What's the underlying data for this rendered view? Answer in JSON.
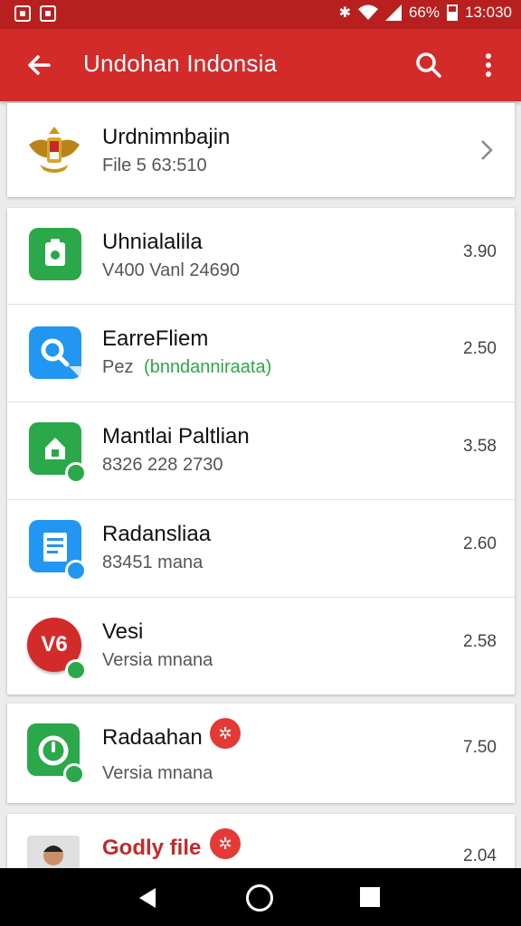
{
  "status_bar": {
    "battery": "66%",
    "time": "13:030"
  },
  "app_bar": {
    "title": "Undohan Indonsia"
  },
  "header_item": {
    "title": "Urdnimnbajin",
    "subtitle": "File 5 63:510"
  },
  "items": [
    {
      "title": "Uhnialalila",
      "subtitle": "V400 Vanl 24690",
      "value": "3.90"
    },
    {
      "title": "EarreFliem",
      "subtitle_prefix": "Pez",
      "subtitle_highlight": "(bnndanniraata)",
      "value": "2.50"
    },
    {
      "title": "Mantlai Paltlian",
      "subtitle": "8326 228 2730",
      "value": "3.58"
    },
    {
      "title": "Radansliaa",
      "subtitle": "83451 mana",
      "value": "2.60"
    },
    {
      "title": "Vesi",
      "subtitle": "Versia mnana",
      "value": "2.58",
      "icon_text": "V6"
    }
  ],
  "item_6": {
    "title": "Radaahan",
    "subtitle": "Versia mnana",
    "value": "7.50"
  },
  "item_7": {
    "title": "Godly file",
    "value": "2.04"
  },
  "colors": {
    "primary": "#d32a2a",
    "status": "#b81f1f",
    "green": "#2aa84a",
    "blue": "#2196f3",
    "red_accent": "#e53935"
  }
}
